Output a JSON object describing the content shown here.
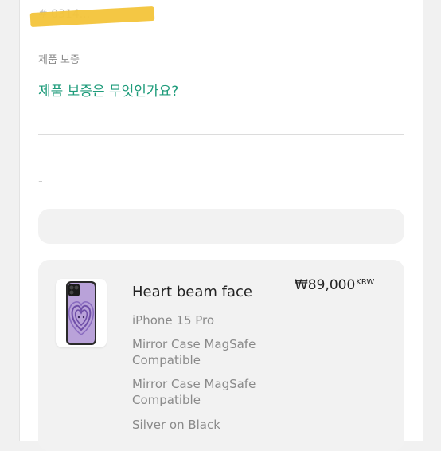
{
  "header": {
    "order_id": "# 0314..."
  },
  "warranty": {
    "section_label": "제품 보증",
    "faq_link": "제품 보증은 무엇인가요?"
  },
  "note": {
    "text": "-"
  },
  "product": {
    "name": "Heart beam face",
    "price": "₩89,000",
    "currency": "KRW",
    "options": {
      "device": "iPhone 15 Pro",
      "case_type_1": "Mirror Case MagSafe Compatible",
      "case_type_2": "Mirror Case MagSafe Compatible",
      "color": "Silver on Black"
    }
  },
  "colors": {
    "accent": "#1f9c7b",
    "redaction": "#f3c43a",
    "card_bg": "#f2f2f2"
  }
}
